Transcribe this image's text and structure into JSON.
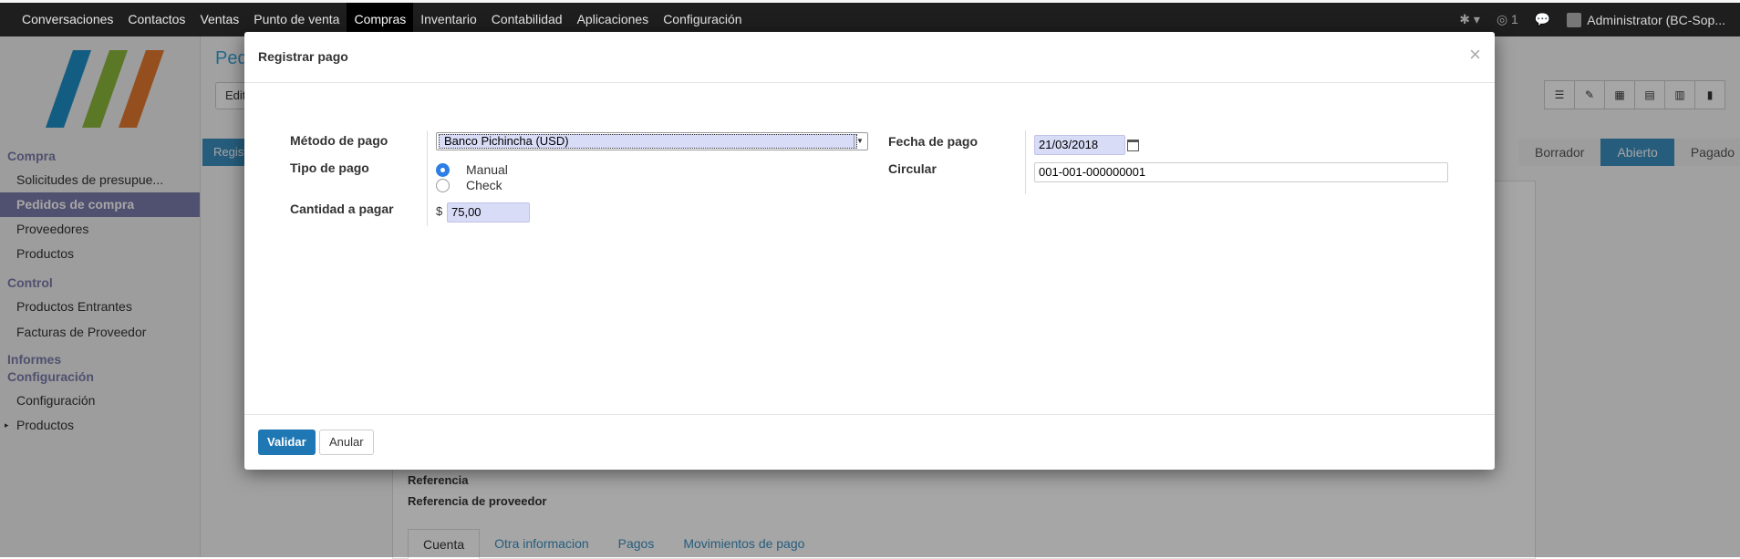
{
  "topnav": {
    "items": [
      "Conversaciones",
      "Contactos",
      "Ventas",
      "Punto de venta",
      "Compras",
      "Inventario",
      "Contabilidad",
      "Aplicaciones",
      "Configuración"
    ],
    "active": "Compras",
    "messages_count": "1",
    "user": "Administrator (BC-Sop..."
  },
  "sidebar": {
    "sections": [
      {
        "title": "Compra",
        "items": [
          "Solicitudes de presupue...",
          "Pedidos de compra",
          "Proveedores",
          "Productos"
        ]
      },
      {
        "title": "Control",
        "items": [
          "Productos Entrantes",
          "Facturas de Proveedor"
        ]
      },
      {
        "title": "Informes"
      },
      {
        "title": "Configuración",
        "items": [
          "Configuración",
          "Productos"
        ]
      }
    ],
    "active_item": "Pedidos de compra"
  },
  "background": {
    "page_title": "Ped",
    "edit_button": "Edit",
    "register_button": "Regist",
    "status_steps": [
      "Borrador",
      "Abierto",
      "Pagado"
    ],
    "status_current": "Abierto",
    "labels": [
      "Referencia",
      "Referencia de proveedor"
    ],
    "tabs": [
      "Cuenta",
      "Otra informacion",
      "Pagos",
      "Movimientos de pago"
    ],
    "active_tab": "Cuenta"
  },
  "modal": {
    "title": "Registrar pago",
    "fields": {
      "payment_method_label": "Método de pago",
      "payment_method_value": "Banco Pichincha (USD)",
      "payment_type_label": "Tipo de pago",
      "payment_type_options": [
        "Manual",
        "Check"
      ],
      "payment_type_selected": "Manual",
      "amount_label": "Cantidad a pagar",
      "currency_symbol": "$",
      "amount_value": "75,00",
      "payment_date_label": "Fecha de pago",
      "payment_date_value": "21/03/2018",
      "circular_label": "Circular",
      "circular_value": "001-001-000000001"
    },
    "buttons": {
      "validate": "Validar",
      "cancel": "Anular"
    }
  }
}
